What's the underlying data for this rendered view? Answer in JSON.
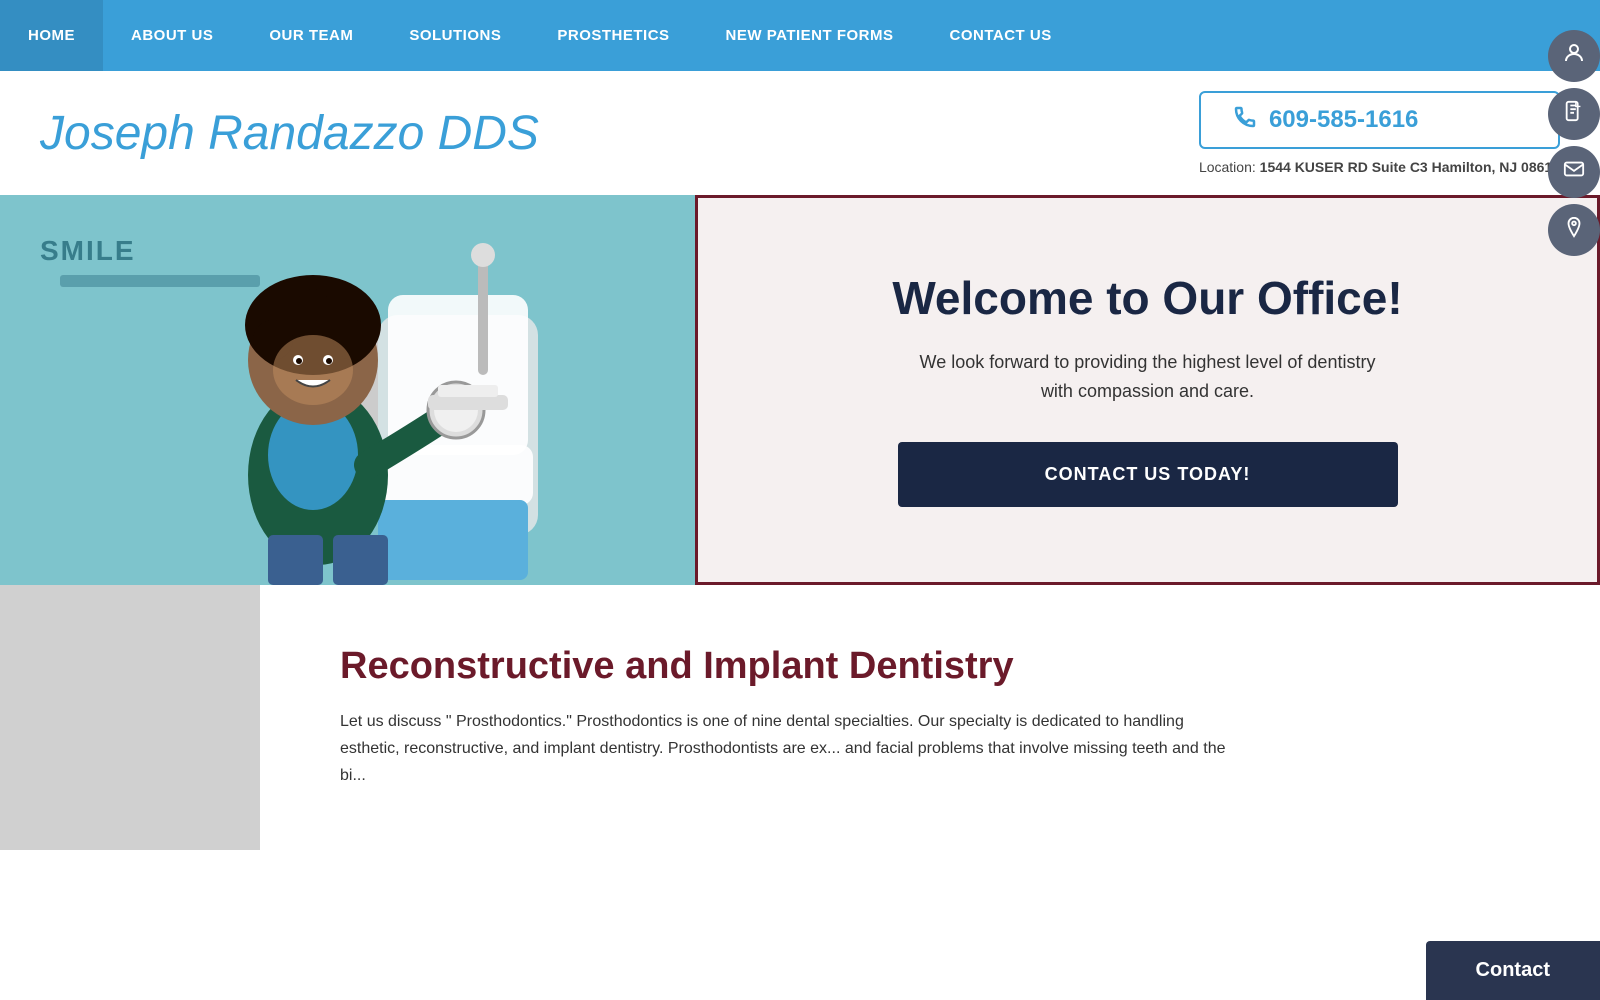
{
  "nav": {
    "items": [
      {
        "id": "home",
        "label": "HOME",
        "active": true
      },
      {
        "id": "about",
        "label": "ABOUT US",
        "active": false
      },
      {
        "id": "team",
        "label": "OUR TEAM",
        "active": false
      },
      {
        "id": "solutions",
        "label": "SOLUTIONS",
        "active": false
      },
      {
        "id": "prosthetics",
        "label": "PROSTHETICS",
        "active": false
      },
      {
        "id": "new-patient",
        "label": "NEW PATIENT FORMS",
        "active": false
      },
      {
        "id": "contact",
        "label": "CONTACT US",
        "active": false
      }
    ]
  },
  "header": {
    "site_title": "Joseph Randazzo DDS",
    "phone": "609-585-1616",
    "location_prefix": "Location:",
    "location_address": "1544 KUSER RD Suite C3 Hamilton, NJ 08619"
  },
  "hero": {
    "welcome_title": "Welcome to Our Office!",
    "welcome_desc": "We look forward to providing the highest level of dentistry with compassion and care.",
    "contact_btn_label": "CONTACT US TODAY!",
    "sign_text": "SMILE"
  },
  "floating_buttons": [
    {
      "id": "user-btn",
      "icon": "👤"
    },
    {
      "id": "doc-btn",
      "icon": "📄"
    },
    {
      "id": "mail-btn",
      "icon": "✉"
    },
    {
      "id": "location-btn",
      "icon": "📍"
    }
  ],
  "lower": {
    "section_title": "Reconstructive and Implant Dentistry",
    "section_desc": "Let us discuss \" Prosthodontics.\" Prosthodontics is one of nine dental specialties. Our specialty is dedicated to handling esthetic, reconstructive, and implant dentistry. Prosthodontists are ex... and facial problems that involve missing teeth and the bi..."
  },
  "contact_bar": {
    "label": "Contact"
  }
}
